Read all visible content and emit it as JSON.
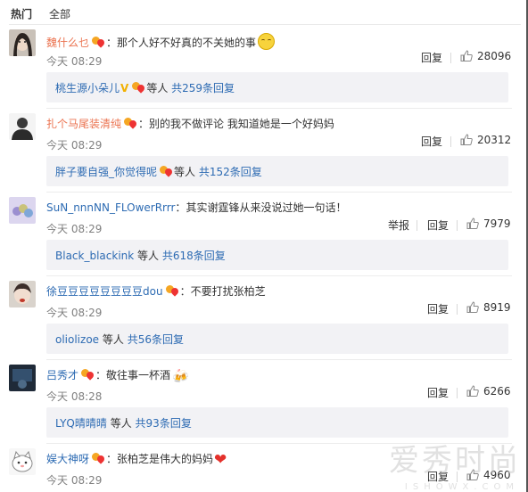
{
  "tabs": {
    "hot": "热门",
    "all": "全部"
  },
  "comments": [
    {
      "user": "魏什么乜",
      "colon": "：",
      "text": "那个人好不好真的不关她的事",
      "time": "今天 08:29",
      "reply_label": "回复",
      "likes": "28096",
      "reply_box": {
        "name": "桃生源小朵儿",
        "vip": "V",
        "who": "等人",
        "count": "共259条回复"
      }
    },
    {
      "user": "扎个马尾装清纯",
      "colon": "：",
      "text": "别的我不做评论 我知道她是一个好妈妈",
      "time": "今天 08:29",
      "reply_label": "回复",
      "likes": "20312",
      "reply_box": {
        "name": "胖子要自强_你觉得呢",
        "who": "等人",
        "count": "共152条回复"
      }
    },
    {
      "user": "SuN_nnnNN_FLOwerRrrr",
      "colon": "：",
      "text": "其实谢霆锋从来没说过她一句话！",
      "time": "今天 08:29",
      "report_label": "举报",
      "reply_label": "回复",
      "likes": "7979",
      "reply_box": {
        "name": "Black_blackink",
        "who": "等人",
        "count": "共618条回复"
      }
    },
    {
      "user": "徐豆豆豆豆豆豆豆豆dou",
      "colon": "：",
      "text": "不要打扰张柏芝",
      "time": "今天 08:29",
      "reply_label": "回复",
      "likes": "8919",
      "reply_box": {
        "name": "oliolizoe",
        "who": "等人",
        "count": "共56条回复"
      }
    },
    {
      "user": "吕秀才",
      "colon": "：",
      "text": "敬往事一杯酒",
      "time": "今天 08:28",
      "reply_label": "回复",
      "likes": "6266",
      "reply_box": {
        "name": "LYQ晴晴晴",
        "who": "等人",
        "count": "共93条回复"
      }
    },
    {
      "user": "娱大神呀",
      "colon": "：",
      "text": "张柏芝是伟大的妈妈",
      "time": "今天 08:29",
      "reply_label": "回复",
      "likes": "4960"
    }
  ],
  "watermark": {
    "main": "爱秀时尚",
    "sub": "ISHOWX.COM"
  },
  "colors": {
    "username": "#eb7350",
    "link": "#2d6bb3",
    "reply_bg": "#f2f2f5"
  }
}
